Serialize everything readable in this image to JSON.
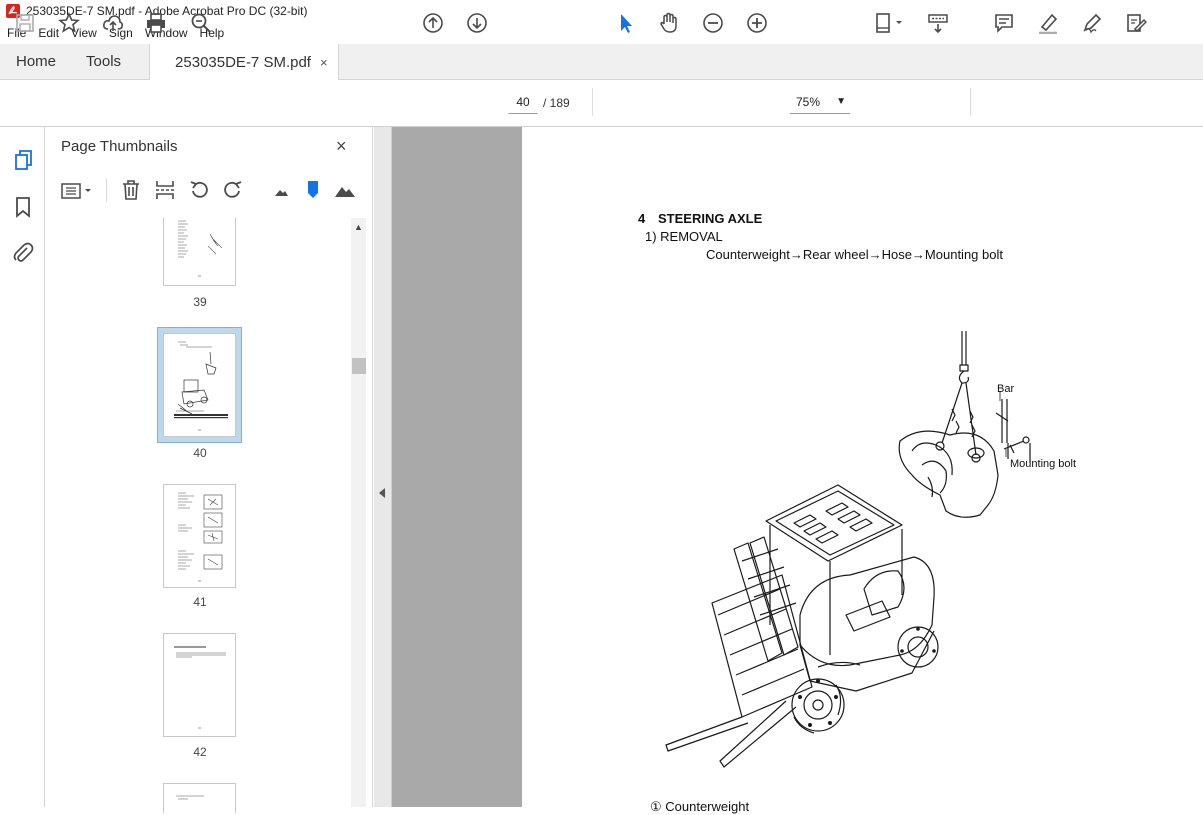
{
  "window": {
    "title": "253035DE-7 SM.pdf - Adobe Acrobat Pro DC (32-bit)"
  },
  "menu": [
    "File",
    "Edit",
    "View",
    "Sign",
    "Window",
    "Help"
  ],
  "tabs": {
    "home": "Home",
    "tools": "Tools",
    "doc": "253035DE-7 SM.pdf",
    "close": "×"
  },
  "nav": {
    "current_page": "40",
    "total_pages": "/ 189",
    "zoom": "75%"
  },
  "panel": {
    "title": "Page Thumbnails",
    "close": "×",
    "thumbnails": [
      {
        "label": "39",
        "selected": false
      },
      {
        "label": "40",
        "selected": true
      },
      {
        "label": "41",
        "selected": false
      },
      {
        "label": "42",
        "selected": false
      }
    ]
  },
  "document": {
    "section_number": "4",
    "section_title": "STEERING AXLE",
    "step": "1)  REMOVAL",
    "sequence": "Counterweight→Rear wheel→Hose→Mounting bolt",
    "label_bar": "Bar",
    "label_bolt": "Mounting bolt",
    "footer_item": "① Counterweight"
  },
  "colors": {
    "accent": "#1473e6",
    "icon": "#4b4b4b",
    "selected_thumb": "#bcd8ec"
  }
}
